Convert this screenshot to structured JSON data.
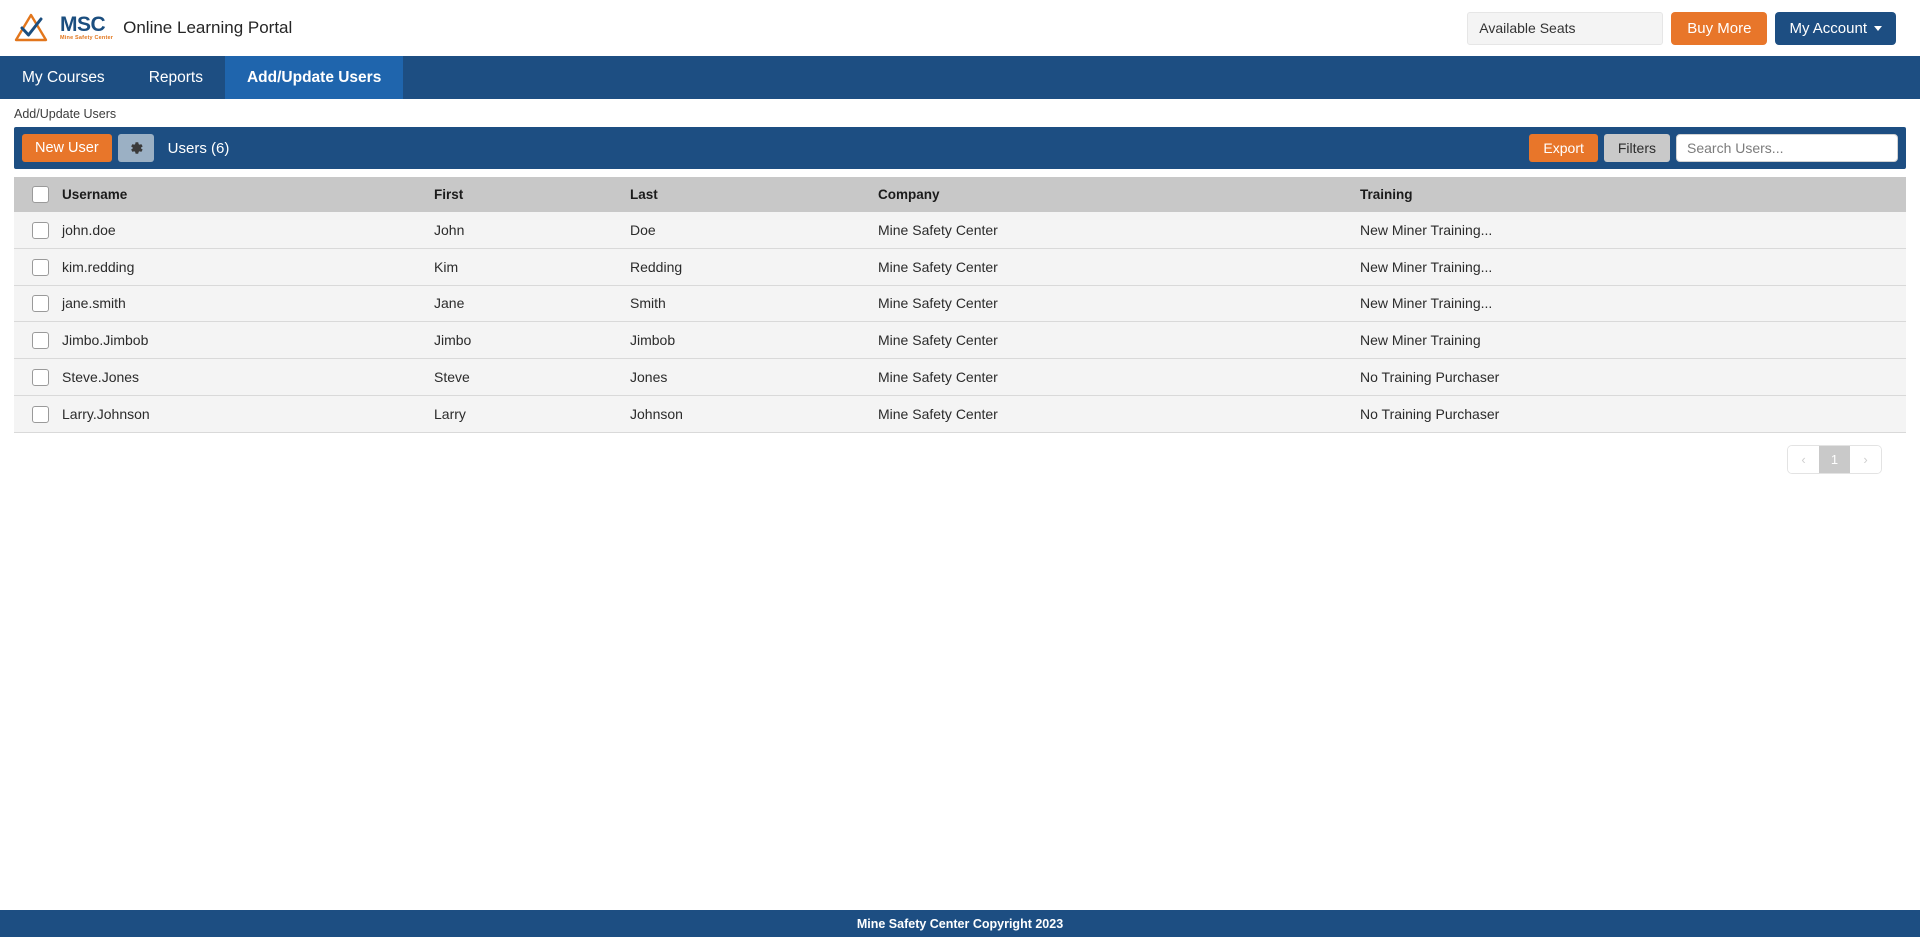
{
  "header": {
    "logo_text": "MSC",
    "logo_subtext": "Mine Safety Center",
    "portal_title": "Online Learning Portal",
    "available_seats_label": "Available Seats",
    "buy_more_label": "Buy More",
    "my_account_label": "My Account"
  },
  "nav": {
    "items": [
      {
        "label": "My Courses",
        "active": false
      },
      {
        "label": "Reports",
        "active": false
      },
      {
        "label": "Add/Update Users",
        "active": true
      }
    ]
  },
  "breadcrumb": {
    "text": "Add/Update Users"
  },
  "toolbar": {
    "new_user_label": "New User",
    "settings_icon": "gear-icon",
    "users_count_label": "Users (6)",
    "export_label": "Export",
    "filters_label": "Filters",
    "search_placeholder": "Search Users...",
    "search_value": ""
  },
  "table": {
    "columns": [
      "Username",
      "First",
      "Last",
      "Company",
      "Training"
    ],
    "rows": [
      {
        "username": "john.doe",
        "first": "John",
        "last": "Doe",
        "company": "Mine Safety Center",
        "training": "New Miner Training..."
      },
      {
        "username": "kim.redding",
        "first": "Kim",
        "last": "Redding",
        "company": "Mine Safety Center",
        "training": "New Miner Training..."
      },
      {
        "username": "jane.smith",
        "first": "Jane",
        "last": "Smith",
        "company": "Mine Safety Center",
        "training": "New Miner Training..."
      },
      {
        "username": "Jimbo.Jimbob",
        "first": "Jimbo",
        "last": "Jimbob",
        "company": "Mine Safety Center",
        "training": "New Miner Training"
      },
      {
        "username": "Steve.Jones",
        "first": "Steve",
        "last": "Jones",
        "company": "Mine Safety Center",
        "training": "No Training Purchaser"
      },
      {
        "username": "Larry.Johnson",
        "first": "Larry",
        "last": "Johnson",
        "company": "Mine Safety Center",
        "training": "No Training Purchaser"
      }
    ]
  },
  "pagination": {
    "prev_label": "‹",
    "next_label": "›",
    "pages": [
      "1"
    ],
    "current_page": "1"
  },
  "footer": {
    "text": "Mine Safety Center Copyright 2023"
  },
  "colors": {
    "navy": "#1d4e82",
    "active_tab_blue": "#1f65ad",
    "orange": "#e8762a",
    "header_gray": "#c8c8c8",
    "row_gray": "#f4f4f4"
  }
}
